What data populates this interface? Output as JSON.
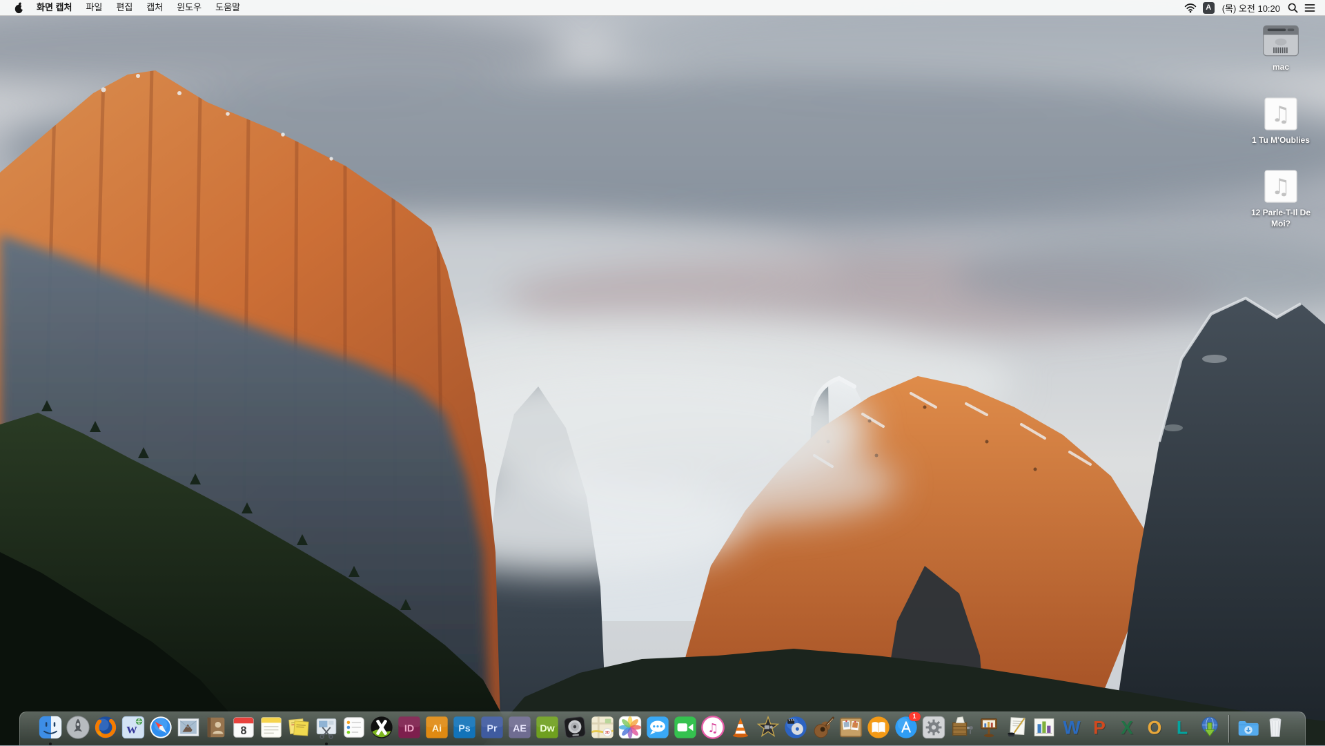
{
  "menu_bar": {
    "apple_icon": "apple-logo",
    "app_name": "화면 캡처",
    "items": [
      "파일",
      "편집",
      "캡처",
      "윈도우",
      "도움말"
    ],
    "status": {
      "icons": [
        "wifi",
        "input-source",
        "clock",
        "spotlight",
        "notification-center"
      ],
      "input_badge": "A",
      "clock": "(목) 오전 10:20"
    }
  },
  "desktop_icons": [
    {
      "id": "macintosh-hd",
      "art": "harddisk",
      "label": "mac"
    },
    {
      "id": "audio-file-1",
      "art": "audio",
      "glyph": "♫",
      "label": "1 Tu M'Oublies"
    },
    {
      "id": "audio-file-2",
      "art": "audio",
      "glyph": "♫",
      "label": "12 Parle-T-Il De Moi?"
    }
  ],
  "dock": {
    "items": [
      {
        "id": "finder",
        "art": "finder",
        "running": true
      },
      {
        "id": "launchpad",
        "art": "launchpad"
      },
      {
        "id": "firefox",
        "art": "firefox"
      },
      {
        "id": "w-globe-app",
        "art": "wglobe",
        "glyph": "w",
        "bg": "#d3e3f4",
        "fg": "#35389b"
      },
      {
        "id": "safari",
        "art": "safari"
      },
      {
        "id": "mail",
        "art": "mail"
      },
      {
        "id": "contacts",
        "art": "contacts"
      },
      {
        "id": "calendar",
        "art": "calendar",
        "glyph": "8"
      },
      {
        "id": "notes",
        "art": "notes"
      },
      {
        "id": "stickies",
        "art": "stickies"
      },
      {
        "id": "grab-screen-capture",
        "art": "grab",
        "running": true
      },
      {
        "id": "reminders",
        "art": "reminders"
      },
      {
        "id": "quarkxpress",
        "art": "quark"
      },
      {
        "id": "indesign",
        "art": "adobe",
        "glyph": "ID",
        "bg": "#7d1f4d",
        "fg": "#f0a8c8"
      },
      {
        "id": "illustrator",
        "art": "adobe",
        "glyph": "Ai",
        "bg": "#e08a12",
        "fg": "#fdf3d7"
      },
      {
        "id": "photoshop",
        "art": "adobe",
        "glyph": "Ps",
        "bg": "#1273b9",
        "fg": "#cfeaff"
      },
      {
        "id": "premiere",
        "art": "adobe",
        "glyph": "Pr",
        "bg": "#3f5ba0",
        "fg": "#dbe6ff"
      },
      {
        "id": "after-effects",
        "art": "adobe",
        "glyph": "AE",
        "bg": "#6f6c91",
        "fg": "#ece9ff"
      },
      {
        "id": "dreamweaver",
        "art": "adobe",
        "glyph": "Dw",
        "bg": "#6fa01f",
        "fg": "#f0ffd8"
      },
      {
        "id": "logic-audio-app",
        "art": "logic"
      },
      {
        "id": "maps",
        "art": "maps",
        "glyph": "3D"
      },
      {
        "id": "photos",
        "art": "photos"
      },
      {
        "id": "messages",
        "art": "messages"
      },
      {
        "id": "facetime",
        "art": "facetime"
      },
      {
        "id": "itunes",
        "art": "itunes",
        "glyph": "♫"
      },
      {
        "id": "vlc",
        "art": "vlc"
      },
      {
        "id": "imovie",
        "art": "imovie"
      },
      {
        "id": "dvd-video-app",
        "art": "dvd"
      },
      {
        "id": "garageband",
        "art": "garageband"
      },
      {
        "id": "collage-board-app",
        "art": "corkboard"
      },
      {
        "id": "ibooks",
        "art": "ibooks"
      },
      {
        "id": "app-store",
        "art": "appstore",
        "badge": "1"
      },
      {
        "id": "system-preferences",
        "art": "sysprefs"
      },
      {
        "id": "stuffit-expander",
        "art": "crate"
      },
      {
        "id": "keynote",
        "art": "keynote"
      },
      {
        "id": "pages",
        "art": "pages"
      },
      {
        "id": "numbers",
        "art": "numbers"
      },
      {
        "id": "word",
        "art": "letter",
        "glyph": "W",
        "fg": "#2b6bbf"
      },
      {
        "id": "powerpoint",
        "art": "letter",
        "glyph": "P",
        "fg": "#d0491f"
      },
      {
        "id": "excel",
        "art": "letter",
        "glyph": "X",
        "fg": "#217346"
      },
      {
        "id": "outlook",
        "art": "letter",
        "glyph": "O",
        "fg": "#e9a83a"
      },
      {
        "id": "lync",
        "art": "letter",
        "glyph": "L",
        "fg": "#03a5a0"
      },
      {
        "id": "download-manager",
        "art": "downloadglobe"
      }
    ],
    "right_items": [
      {
        "id": "downloads-folder",
        "art": "folder"
      },
      {
        "id": "trash",
        "art": "trash"
      }
    ]
  },
  "theme": {
    "menubar_bg": "#f7f8f8",
    "dock_tint": "#5c665f",
    "badge_red": "#ff3b30",
    "desktop_label_color": "#ffffff"
  }
}
